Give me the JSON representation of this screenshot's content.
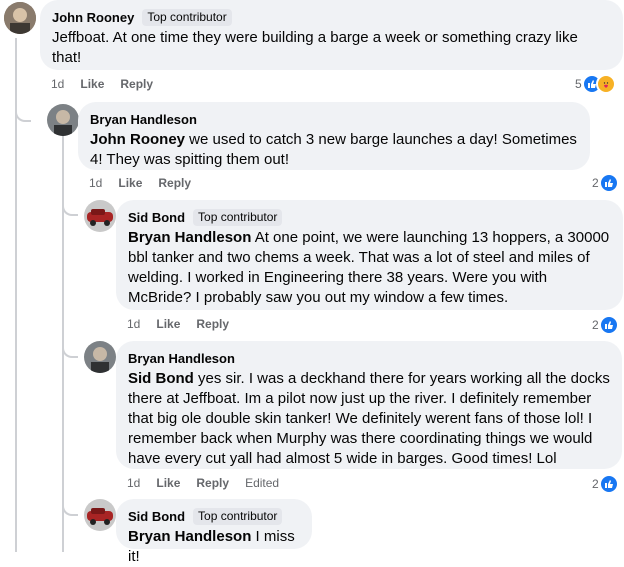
{
  "comments": [
    {
      "author": "John Rooney",
      "badge": "Top contributor",
      "mention": "",
      "text": "Jeffboat. At one time they were building a barge a week or something crazy like that!",
      "time": "1d",
      "like": "Like",
      "reply": "Reply",
      "reactions": "5",
      "avatar_color": "#7a6a5a"
    },
    {
      "author": "Bryan Handleson",
      "badge": "",
      "mention": "John Rooney",
      "text": " we used to catch 3 new barge launches a day! Sometimes 4! They was spitting them out!",
      "time": "1d",
      "like": "Like",
      "reply": "Reply",
      "reactions": "2",
      "avatar_color": "#6b6f73"
    },
    {
      "author": "Sid Bond",
      "badge": "Top contributor",
      "mention": "Bryan Handleson",
      "text": " At one point, we were launching 13 hoppers, a 30000 bbl tanker and two chems a week. That was a lot of steel and miles of welding. I worked in Engineering there 38 years. Were you with McBride? I probably saw you out my window a few times.",
      "time": "1d",
      "like": "Like",
      "reply": "Reply",
      "reactions": "2",
      "avatar_color": "#9b3030"
    },
    {
      "author": "Bryan Handleson",
      "badge": "",
      "mention": "Sid Bond",
      "text": " yes sir. I was a deckhand there for years working all the docks there at Jeffboat. Im a pilot now just up the river. I definitely remember that big ole double skin tanker! We definitely werent fans of those lol! I remember back when Murphy was there coordinating things we would have every cut yall had almost 5 wide in barges. Good times! Lol",
      "time": "1d",
      "like": "Like",
      "reply": "Reply",
      "edited": "Edited",
      "reactions": "2",
      "avatar_color": "#6b6f73"
    },
    {
      "author": "Sid Bond",
      "badge": "Top contributor",
      "mention": "Bryan Handleson",
      "text": " I miss it!",
      "avatar_color": "#9b3030"
    }
  ]
}
